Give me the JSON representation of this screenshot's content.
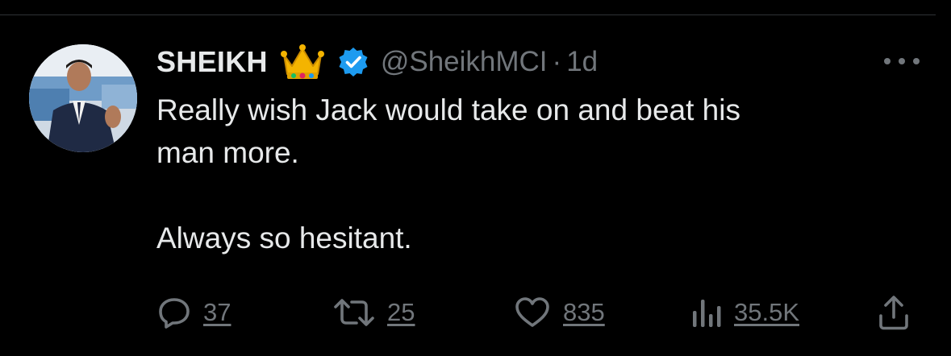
{
  "tweet": {
    "display_name": "SHEIKH",
    "name_emoji": "crown",
    "verified": true,
    "handle": "@SheikhMCI",
    "separator": "·",
    "time": "1d",
    "text_lines": [
      "Really wish Jack would take on and beat his",
      "man more."
    ],
    "text_second_paragraph": "Always so hesitant."
  },
  "actions": {
    "replies": "37",
    "retweets": "25",
    "likes": "835",
    "views": "35.5K"
  },
  "icons": {
    "avatar": "profile-photo",
    "crown": "crown-icon",
    "verified": "verified-badge-icon",
    "more": "more-icon",
    "reply": "reply-icon",
    "retweet": "retweet-icon",
    "like": "heart-icon",
    "views": "views-icon",
    "share": "share-icon"
  },
  "colors": {
    "background": "#000000",
    "text": "#e7e9ea",
    "muted": "#71767b",
    "verified_blue": "#1d9bf0",
    "divider": "#2f3336"
  }
}
